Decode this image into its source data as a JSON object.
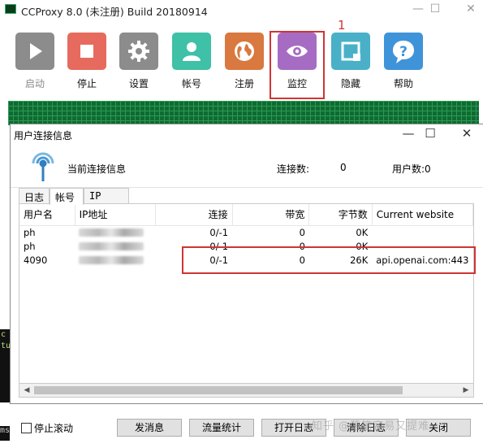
{
  "main_window": {
    "title": "CCProxy 8.0 (未注册) Build 20180914",
    "controls": {
      "minimize": "—",
      "maximize": "☐",
      "close": "✕"
    }
  },
  "toolbar": {
    "buttons": [
      {
        "label": "启动",
        "icon": "play-icon",
        "color": "#8c8c8c",
        "disabled": true
      },
      {
        "label": "停止",
        "icon": "stop-icon",
        "color": "#e66b5e"
      },
      {
        "label": "设置",
        "icon": "gear-icon",
        "color": "#8c8c8c"
      },
      {
        "label": "帐号",
        "icon": "user-icon",
        "color": "#3ec1a6"
      },
      {
        "label": "注册",
        "icon": "globe-icon",
        "color": "#d9783f"
      },
      {
        "label": "监控",
        "icon": "eye-icon",
        "color": "#a66cc3"
      },
      {
        "label": "隐藏",
        "icon": "hide-window-icon",
        "color": "#4ab0c8"
      },
      {
        "label": "帮助",
        "icon": "help-bubble-icon",
        "color": "#3f93d9"
      }
    ]
  },
  "annotation": {
    "marker": "1",
    "highlight_color": "#d03434"
  },
  "dialog": {
    "title": "用户连接信息",
    "controls": {
      "minimize": "—",
      "maximize": "☐",
      "close": "✕"
    },
    "header": {
      "title": "当前连接信息",
      "connections_label": "连接数:",
      "connections_value": "0",
      "users_label": "用户数:0"
    },
    "tabs": [
      {
        "label": "日志"
      },
      {
        "label": "帐号",
        "active": true
      },
      {
        "label": "IP"
      }
    ],
    "table": {
      "columns": [
        "用户名",
        "IP地址",
        "连接",
        "带宽",
        "字节数",
        "Current website"
      ],
      "rows": [
        {
          "user": "ph",
          "ip": "",
          "conn": "0/-1",
          "bw": "0",
          "bytes": "0K",
          "site": ""
        },
        {
          "user": "ph",
          "ip": "",
          "conn": "0/-1",
          "bw": "0",
          "bytes": "0K",
          "site": ""
        },
        {
          "user": "4090",
          "ip": "",
          "conn": "0/-1",
          "bw": "0",
          "bytes": "26K",
          "site": "api.openai.com:443"
        }
      ]
    },
    "scrollbar": {
      "left_arrow": "◀",
      "right_arrow": "▶"
    }
  },
  "bottom": {
    "stop_scroll_label": "停止滚动",
    "buttons": [
      "发消息",
      "流量统计",
      "打开日志",
      "清除日志",
      "关闭"
    ]
  },
  "background_terminal": {
    "line1": "c",
    "line2": "tu",
    "line3": "ms"
  },
  "watermark": "知乎 @落笔容易又提难"
}
